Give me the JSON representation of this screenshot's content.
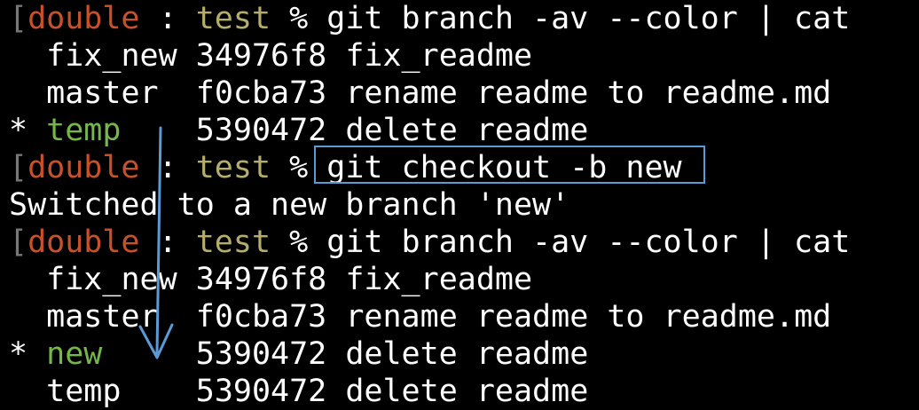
{
  "prompt": {
    "bracket": "[",
    "user": "double",
    "separator": " : ",
    "dir": "test",
    "symbol": " % "
  },
  "commands": {
    "branch_list": "git branch -av --color | cat",
    "checkout": "git checkout -b new"
  },
  "first_branch_listing": [
    {
      "marker": " ",
      "name": "fix_new",
      "pad": " ",
      "hash": "34976f8",
      "message": "fix_readme",
      "current": false
    },
    {
      "marker": " ",
      "name": "master",
      "pad": "  ",
      "hash": "f0cba73",
      "message": "rename readme to readme.md",
      "current": false
    },
    {
      "marker": "*",
      "name": "temp",
      "pad": "    ",
      "hash": "5390472",
      "message": "delete readme",
      "current": true
    }
  ],
  "checkout_output": "Switched to a new branch 'new'",
  "second_branch_listing": [
    {
      "marker": " ",
      "name": "fix_new",
      "pad": " ",
      "hash": "34976f8",
      "message": "fix_readme",
      "current": false
    },
    {
      "marker": " ",
      "name": "master",
      "pad": "  ",
      "hash": "f0cba73",
      "message": "rename readme to readme.md",
      "current": false
    },
    {
      "marker": "*",
      "name": "new",
      "pad": "     ",
      "hash": "5390472",
      "message": "delete readme",
      "current": true
    },
    {
      "marker": " ",
      "name": "temp",
      "pad": "    ",
      "hash": "5390472",
      "message": "delete readme",
      "current": false
    }
  ],
  "colors": {
    "background": "#000000",
    "user": "#c7522a",
    "dir": "#b5ad6a",
    "current_branch": "#74b84a",
    "annotation": "#5b9bd5"
  }
}
